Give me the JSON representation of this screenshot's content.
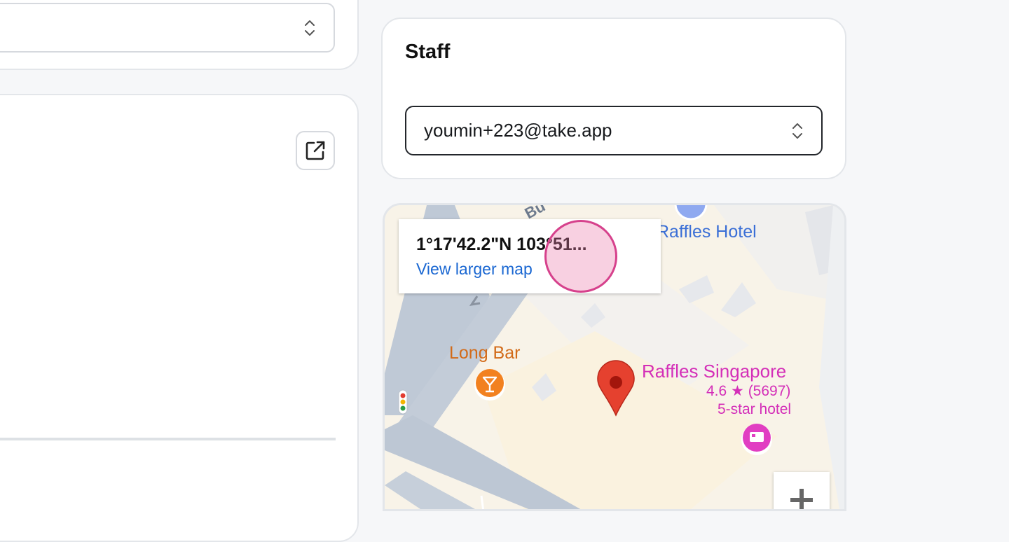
{
  "left_panel": {
    "select_value": ""
  },
  "staff": {
    "title": "Staff",
    "selected_email": "youmin+223@take.app"
  },
  "map": {
    "coordinates": "1°17'42.2\"N 103°51...",
    "larger_map_link": "View larger map",
    "labels": {
      "raffles_hotel": "Raffles Hotel",
      "long_bar": "Long Bar",
      "raffles_singapore": "Raffles Singapore",
      "rating": "4.6 ★ (5697)",
      "hotel_class": "5-star hotel"
    }
  },
  "colors": {
    "accent_link": "#1a67d2",
    "hotel_pink": "#d42fb8",
    "bar_orange": "#f2811f",
    "marker_red": "#e5412f"
  }
}
